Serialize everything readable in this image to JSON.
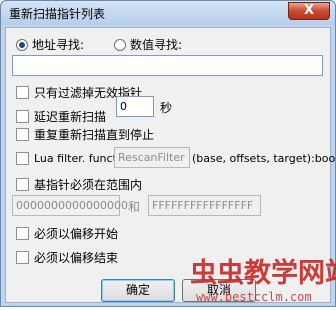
{
  "window": {
    "title": "重新扫描指针列表",
    "close_label": "X"
  },
  "search_mode": {
    "address_label": "地址寻找:",
    "value_label": "数值寻找:",
    "selected": "address"
  },
  "address_input": {
    "value": ""
  },
  "options": {
    "filter_invalid": "只有过滤掉无效指针",
    "delay_rescan": "延迟重新扫描",
    "delay_value": "0",
    "delay_unit": "秒",
    "repeat_rescan": "重复重新扫描直到停止",
    "lua_prefix": "Lua filter. function",
    "lua_function": "RescanFilter",
    "lua_suffix": "(base, offsets, target):bool",
    "base_in_range": "基指针必须在范围内",
    "range_from": "0000000000000000",
    "range_and": "和",
    "range_to": "FFFFFFFFFFFFFFFF",
    "must_start_offset": "必须以偏移开始",
    "must_end_offset": "必须以偏移结束"
  },
  "buttons": {
    "ok": "确定",
    "cancel": "取消"
  },
  "watermark": {
    "text": "虫虫教学网站",
    "url": "www.bestcclm.com"
  }
}
